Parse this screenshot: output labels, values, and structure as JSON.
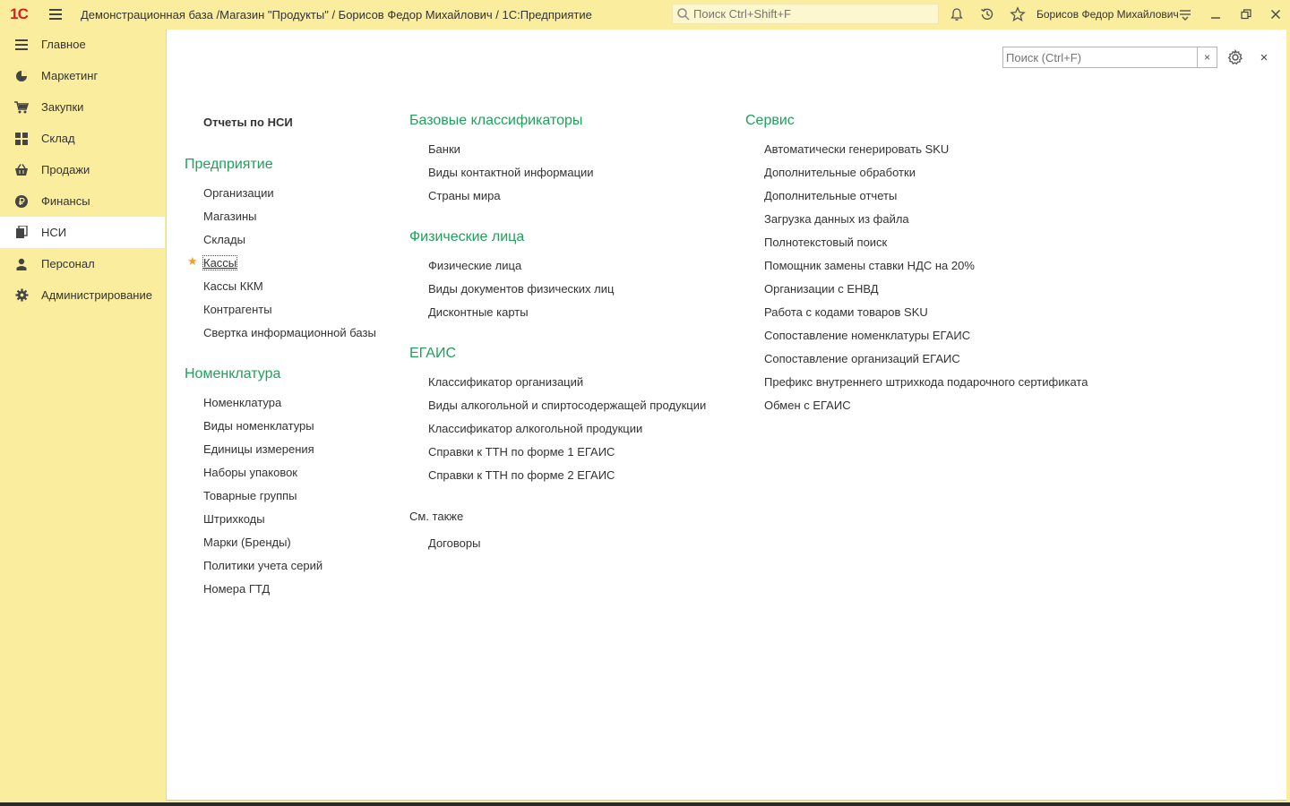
{
  "titlebar": {
    "logo": "1С",
    "title": "Демонстрационная база /Магазин \"Продукты\" / Борисов Федор Михайлович / 1С:Предприятие",
    "search_placeholder": "Поиск Ctrl+Shift+F",
    "user": "Борисов Федор Михайлович"
  },
  "sidebar": {
    "items": [
      {
        "label": "Главное",
        "icon": "hamburger-icon"
      },
      {
        "label": "Маркетинг",
        "icon": "pie-chart-icon"
      },
      {
        "label": "Закупки",
        "icon": "cart-icon"
      },
      {
        "label": "Склад",
        "icon": "grid-icon"
      },
      {
        "label": "Продажи",
        "icon": "shopping-basket-icon"
      },
      {
        "label": "Финансы",
        "icon": "ruble-icon"
      },
      {
        "label": "НСИ",
        "icon": "documents-icon",
        "active": true
      },
      {
        "label": "Персонал",
        "icon": "person-icon"
      },
      {
        "label": "Администрирование",
        "icon": "gear-icon"
      }
    ]
  },
  "form": {
    "search_placeholder": "Поиск (Ctrl+F)",
    "clear": "×",
    "close": "×"
  },
  "col1": {
    "reports_title": "Отчеты по НСИ",
    "enterprise_title": "Предприятие",
    "enterprise_items": [
      "Организации",
      "Магазины",
      "Склады",
      "Кассы",
      "Кассы ККМ",
      "Контрагенты",
      "Свертка информационной базы"
    ],
    "nomenclature_title": "Номенклатура",
    "nomenclature_items": [
      "Номенклатура",
      "Виды номенклатуры",
      "Единицы измерения",
      "Наборы упаковок",
      "Товарные группы",
      "Штрихкоды",
      "Марки (Бренды)",
      "Политики учета серий",
      "Номера ГТД"
    ]
  },
  "col2": {
    "basic_title": "Базовые классификаторы",
    "basic_items": [
      "Банки",
      "Виды контактной информации",
      "Страны мира"
    ],
    "persons_title": "Физические лица",
    "persons_items": [
      "Физические лица",
      "Виды документов физических лиц",
      "Дисконтные карты"
    ],
    "egais_title": "ЕГАИС",
    "egais_items": [
      "Классификатор организаций",
      "Виды алкогольной и спиртосодержащей продукции",
      "Классификатор алкогольной продукции",
      "Справки к ТТН по форме 1 ЕГАИС",
      "Справки к ТТН по форме 2 ЕГАИС"
    ],
    "see_also_title": "См. также",
    "see_also_items": [
      "Договоры"
    ]
  },
  "col3": {
    "service_title": "Сервис",
    "service_items": [
      "Автоматически генерировать SKU",
      "Дополнительные обработки",
      "Дополнительные отчеты",
      "Загрузка данных из файла",
      "Полнотекстовый поиск",
      "Помощник замены ставки НДС на 20%",
      "Организации с ЕНВД",
      "Работа с кодами товаров SKU",
      "Сопоставление номенклатуры ЕГАИС",
      "Сопоставление организаций ЕГАИС",
      "Префикс внутреннего штрихкода подарочного сертификата",
      "Обмен с ЕГАИС"
    ]
  },
  "colors": {
    "accent_green": "#1ea25a",
    "panel_yellow": "#fbed9e",
    "logo_red": "#d71f26",
    "favorite_star": "#f0a030"
  }
}
